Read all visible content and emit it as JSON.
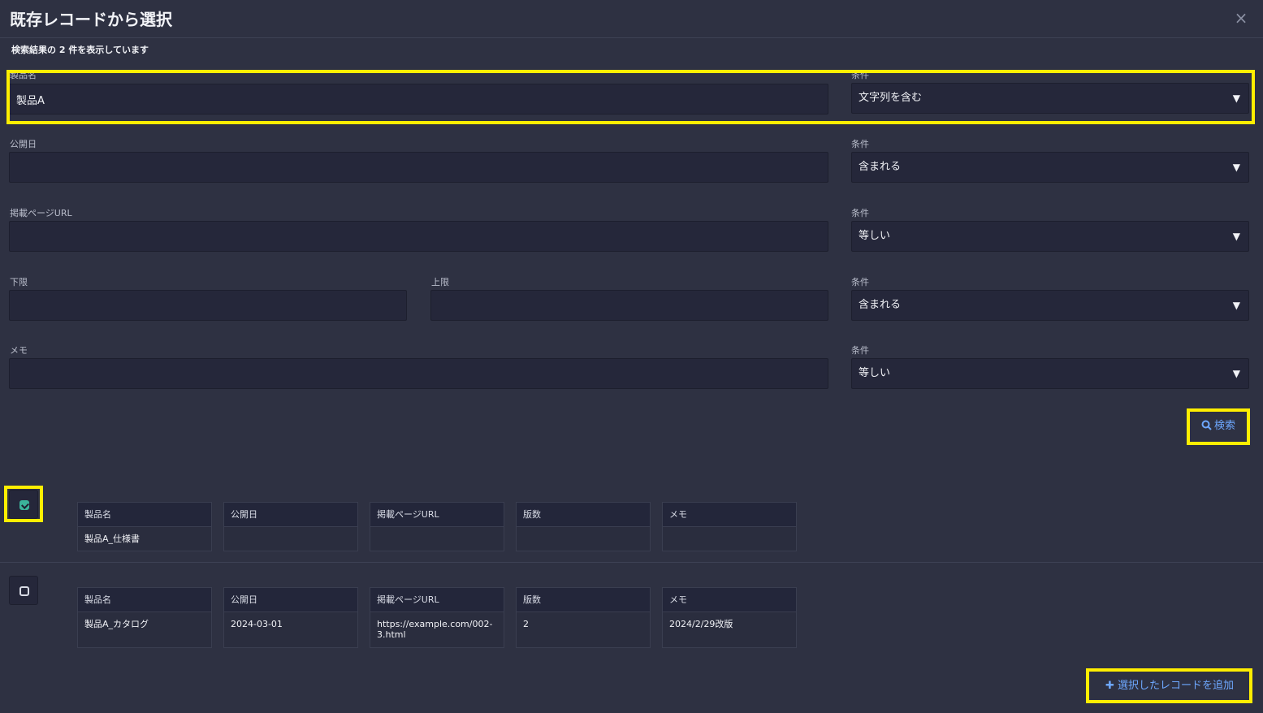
{
  "dialog": {
    "title": "既存レコードから選択",
    "close_icon": "×",
    "summary": "検索結果の 2 件を表示しています"
  },
  "filters": {
    "product_name": {
      "label": "製品名",
      "value": "製品A",
      "condition_label": "条件",
      "condition": "文字列を含む"
    },
    "publish_date": {
      "label": "公開日",
      "value": "",
      "condition_label": "条件",
      "condition": "含まれる"
    },
    "page_url": {
      "label": "掲載ページURL",
      "value": "",
      "condition_label": "条件",
      "condition": "等しい"
    },
    "range": {
      "lower_label": "下限",
      "lower_value": "",
      "upper_label": "上限",
      "upper_value": "",
      "condition_label": "条件",
      "condition": "含まれる"
    },
    "memo": {
      "label": "メモ",
      "value": "",
      "condition_label": "条件",
      "condition": "等しい"
    }
  },
  "search_button": {
    "label": "検索",
    "icon": "search-icon"
  },
  "results": [
    {
      "checked": true,
      "fields": [
        {
          "header": "製品名",
          "value": "製品A_仕様書"
        },
        {
          "header": "公開日",
          "value": ""
        },
        {
          "header": "掲載ページURL",
          "value": ""
        },
        {
          "header": "版数",
          "value": ""
        },
        {
          "header": "メモ",
          "value": ""
        }
      ]
    },
    {
      "checked": false,
      "fields": [
        {
          "header": "製品名",
          "value": "製品A_カタログ"
        },
        {
          "header": "公開日",
          "value": "2024-03-01"
        },
        {
          "header": "掲載ページURL",
          "value": "https://example.com/002-3.html"
        },
        {
          "header": "版数",
          "value": "2"
        },
        {
          "header": "メモ",
          "value": "2024/2/29改版"
        }
      ]
    }
  ],
  "add_button": {
    "label": "選択したレコードを追加",
    "icon": "plus-icon"
  },
  "colors": {
    "background": "#2e3142",
    "input": "#25273a",
    "accent": "#6ea8ff",
    "highlight": "#ffee00",
    "check": "#3bb39a"
  }
}
